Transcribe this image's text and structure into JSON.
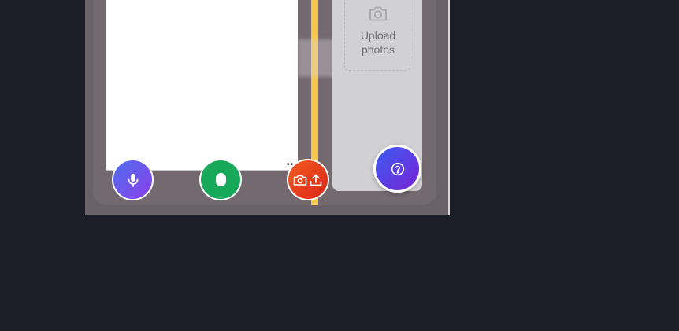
{
  "upload_zone": {
    "label": "Upload\nphotos",
    "icon": "camera-icon"
  },
  "buttons": {
    "mic": {
      "icon": "microphone-icon"
    },
    "record": {
      "icon": "record-icon"
    },
    "camera_upload": {
      "icons": [
        "camera-icon",
        "upload-icon"
      ]
    },
    "help": {
      "icon": "question-icon"
    }
  },
  "colors": {
    "background": "#1b1e26",
    "accent_yellow": "#f5c84b",
    "mic_gradient": [
      "#4f6ef0",
      "#8b3ee6"
    ],
    "record_green": "#17a859",
    "camera_gradient": [
      "#f45a1e",
      "#d8271c"
    ],
    "help_gradient": [
      "#3a5cf0",
      "#7a23d8"
    ]
  }
}
